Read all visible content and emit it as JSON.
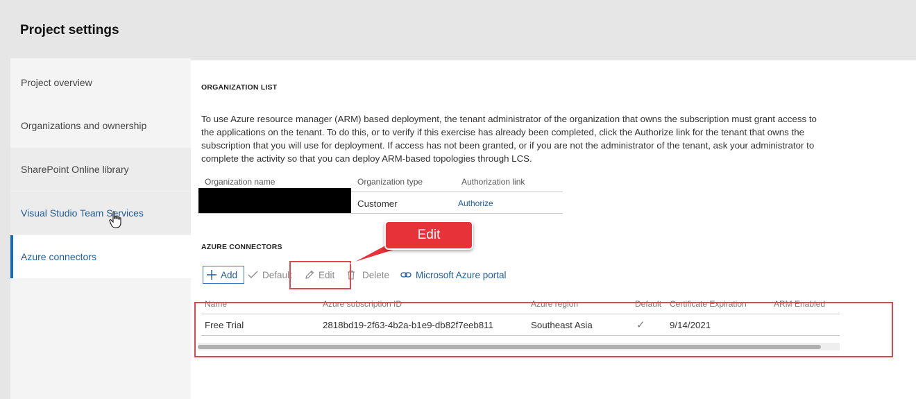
{
  "header": {
    "title": "Project settings"
  },
  "sidebar": {
    "items": [
      {
        "label": "Project overview"
      },
      {
        "label": "Organizations and ownership"
      },
      {
        "label": "SharePoint Online library"
      },
      {
        "label": "Visual Studio Team Services"
      },
      {
        "label": "Azure connectors"
      }
    ]
  },
  "org_list": {
    "title": "ORGANIZATION LIST",
    "description": "To use Azure resource manager (ARM) based deployment, the tenant administrator of the organization that owns the subscription must grant access to the applications on the tenant. To do this, or to verify if this exercise has already been completed, click the Authorize link for the tenant that owns the subscription that you will use for deployment. If access has not been granted, or if you are not the administrator of the tenant, ask your administrator to complete the activity so that you can deploy ARM-based topologies through LCS.",
    "columns": [
      "Organization name",
      "Organization type",
      "Authorization link"
    ],
    "row": {
      "type": "Customer",
      "link": "Authorize"
    }
  },
  "azure_connectors": {
    "title": "AZURE CONNECTORS",
    "toolbar": {
      "add": "Add",
      "default": "Default",
      "edit": "Edit",
      "delete": "Delete",
      "portal": "Microsoft Azure portal"
    },
    "columns": [
      "Name",
      "Azure subscription ID",
      "Azure region",
      "Default",
      "Certificate Expiration",
      "ARM Enabled"
    ],
    "rows": [
      {
        "name": "Free Trial",
        "subscription_id": "2818bd19-2f63-4b2a-b1e9-db82f7eeb811",
        "region": "Southeast Asia",
        "default": "✓",
        "expiration": "9/14/2021",
        "arm_enabled": ""
      }
    ]
  },
  "annotation": {
    "callout": "Edit"
  },
  "colors": {
    "accent": "#0f6cbd",
    "link": "#1f5c99",
    "highlight": "#e0474c",
    "callout": "#e8323a"
  }
}
